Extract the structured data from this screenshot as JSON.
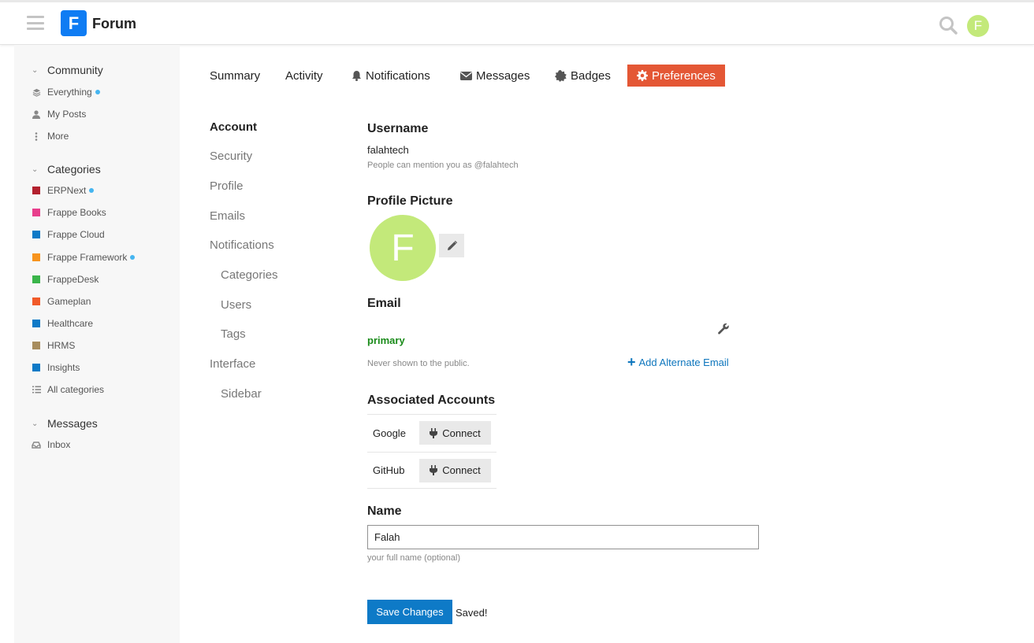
{
  "header": {
    "logo_letter": "F",
    "brand": "Forum",
    "avatar_letter": "F"
  },
  "sidebar": {
    "community": {
      "title": "Community",
      "items": [
        {
          "label": "Everything",
          "icon": "layers-icon",
          "new": true
        },
        {
          "label": "My Posts",
          "icon": "user-icon",
          "new": false
        },
        {
          "label": "More",
          "icon": "more-vertical-icon",
          "new": false
        }
      ]
    },
    "categories": {
      "title": "Categories",
      "items": [
        {
          "label": "ERPNext",
          "color": "#b3202e",
          "new": true
        },
        {
          "label": "Frappe Books",
          "color": "#e83e8c",
          "new": false
        },
        {
          "label": "Frappe Cloud",
          "color": "#0e7ac7",
          "new": false
        },
        {
          "label": "Frappe Framework",
          "color": "#f7941d",
          "new": true
        },
        {
          "label": "FrappeDesk",
          "color": "#3ab54a",
          "new": false
        },
        {
          "label": "Gameplan",
          "color": "#f15a29",
          "new": false
        },
        {
          "label": "Healthcare",
          "color": "#0e7ac7",
          "new": false
        },
        {
          "label": "HRMS",
          "color": "#a88d5e",
          "new": false
        },
        {
          "label": "Insights",
          "color": "#0e7ac7",
          "new": false
        }
      ],
      "all_label": "All categories"
    },
    "messages": {
      "title": "Messages",
      "items": [
        {
          "label": "Inbox",
          "icon": "inbox-icon"
        }
      ]
    }
  },
  "tabs": [
    {
      "label": "Summary"
    },
    {
      "label": "Activity"
    },
    {
      "label": "Notifications"
    },
    {
      "label": "Messages"
    },
    {
      "label": "Badges"
    },
    {
      "label": "Preferences"
    }
  ],
  "subnav": [
    {
      "label": "Account"
    },
    {
      "label": "Security"
    },
    {
      "label": "Profile"
    },
    {
      "label": "Emails"
    },
    {
      "label": "Notifications"
    },
    {
      "label": "Categories"
    },
    {
      "label": "Users"
    },
    {
      "label": "Tags"
    },
    {
      "label": "Interface"
    },
    {
      "label": "Sidebar"
    }
  ],
  "account": {
    "username_heading": "Username",
    "username": "falahtech",
    "username_hint": "People can mention you as @falahtech",
    "picture_heading": "Profile Picture",
    "avatar_letter": "F",
    "email_heading": "Email",
    "email_primary": "primary",
    "email_hint": "Never shown to the public.",
    "add_email": "Add Alternate Email",
    "associated_heading": "Associated Accounts",
    "accounts": [
      {
        "name": "Google",
        "action": "Connect"
      },
      {
        "name": "GitHub",
        "action": "Connect"
      }
    ],
    "name_heading": "Name",
    "name_value": "Falah",
    "name_hint": "your full name (optional)",
    "save_label": "Save Changes",
    "saved_text": "Saved!"
  }
}
